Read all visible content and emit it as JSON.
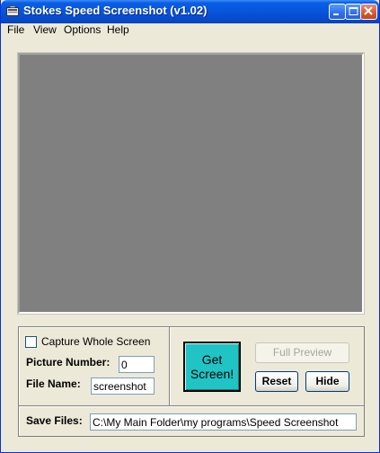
{
  "window": {
    "title": "Stokes Speed Screenshot (v1.02)",
    "controls": [
      "minimize-icon",
      "maximize-icon",
      "close-icon"
    ]
  },
  "menu": {
    "items": [
      {
        "label": "File"
      },
      {
        "label": "View"
      },
      {
        "label": "Options"
      },
      {
        "label": "Help"
      }
    ]
  },
  "options": {
    "capture_whole_screen_label": "Capture Whole Screen",
    "capture_whole_screen_checked": false,
    "picture_number_label": "Picture Number:",
    "picture_number_value": "0",
    "file_name_label": "File Name:",
    "file_name_value": "screenshot"
  },
  "actions": {
    "get_screen_line1": "Get",
    "get_screen_line2": "Screen!",
    "full_preview_label": "Full Preview",
    "reset_label": "Reset",
    "hide_label": "Hide"
  },
  "save": {
    "label": "Save Files:",
    "path": "C:\\My Main Folder\\my programs\\Speed Screenshot"
  },
  "colors": {
    "titlebar": "#0653d8",
    "window_bg": "#ece9d8",
    "preview_bg": "#808080",
    "get_screen_bg": "#20c4c4"
  }
}
